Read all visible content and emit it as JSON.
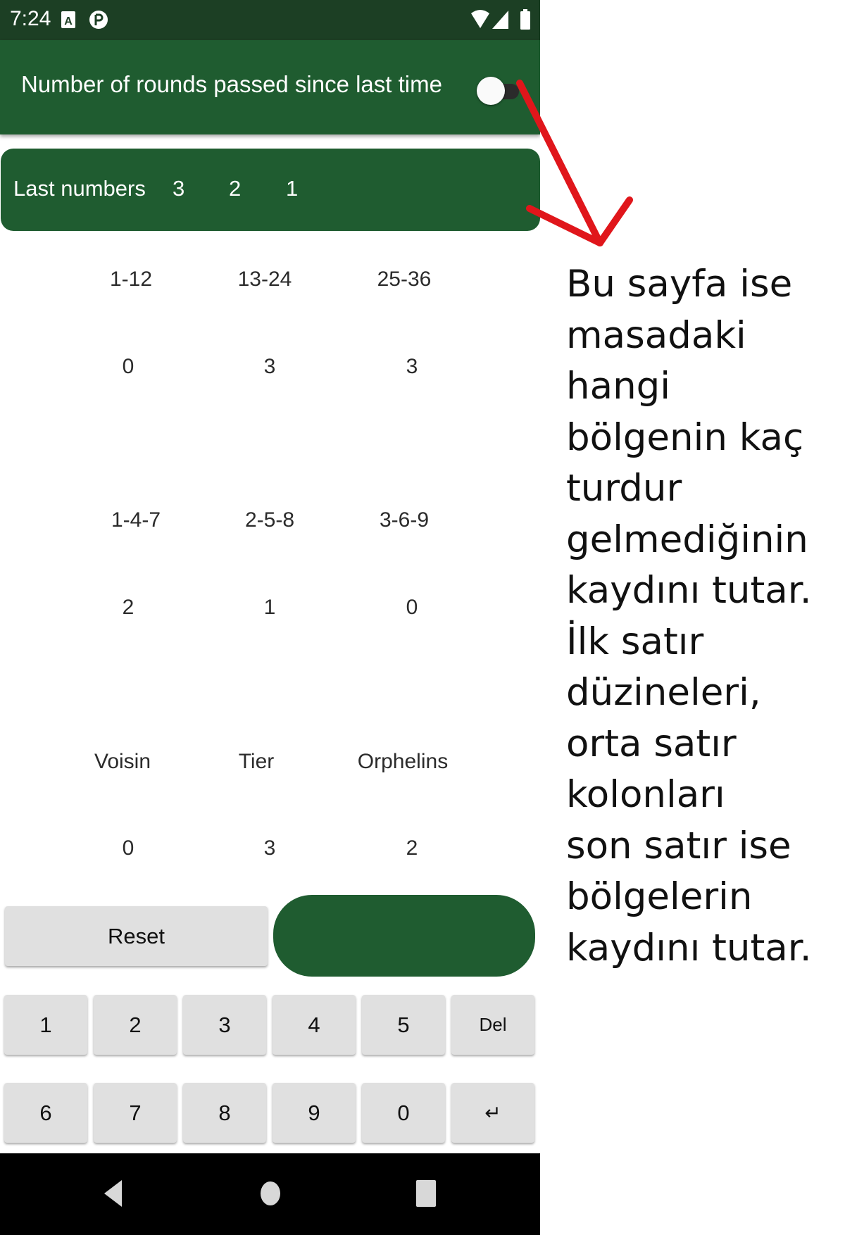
{
  "status_bar": {
    "time": "7:24",
    "icons": [
      "a-badge-icon",
      "p-circle-icon",
      "wifi-icon",
      "signal-icon",
      "battery-icon"
    ]
  },
  "app_bar": {
    "title": "Number of rounds passed since last time",
    "toggle_state": "off"
  },
  "last_numbers": {
    "label": "Last numbers",
    "values": [
      "3",
      "2",
      "1"
    ]
  },
  "grid": {
    "dozens": {
      "headers": [
        "1-12",
        "13-24",
        "25-36"
      ],
      "values": [
        "0",
        "3",
        "3"
      ]
    },
    "columns": {
      "headers": [
        "1-4-7",
        "2-5-8",
        "3-6-9"
      ],
      "values": [
        "2",
        "1",
        "0"
      ]
    },
    "sectors": {
      "headers": [
        "Voisin",
        "Tier",
        "Orphelins"
      ],
      "values": [
        "0",
        "3",
        "2"
      ]
    }
  },
  "buttons": {
    "reset": "Reset"
  },
  "keypad": {
    "row1": [
      "1",
      "2",
      "3",
      "4",
      "5",
      "Del"
    ],
    "row2": [
      "6",
      "7",
      "8",
      "9",
      "0",
      "↵"
    ]
  },
  "nav_icons": [
    "back-icon",
    "home-icon",
    "recents-icon"
  ],
  "annotation": "Bu sayfa ise\nmasadaki hangi\nbölgenin kaç\nturdur\ngelmediğinin\nkaydını tutar.\nİlk satır\ndüzineleri,\norta satır\nkolonları\nson satır ise\nbölgelerin\nkaydını tutar.",
  "colors": {
    "primary": "#1f5c30",
    "status_bar": "#1c3f24",
    "arrow": "#e0161b",
    "key_bg": "#e0e0e0"
  }
}
